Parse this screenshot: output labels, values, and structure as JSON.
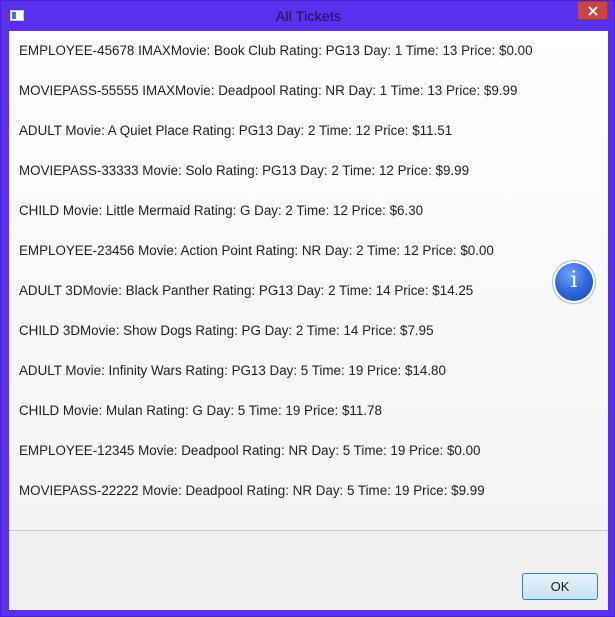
{
  "window": {
    "title": "All Tickets",
    "icon": "app-window-icon",
    "close_icon": "close-x-icon"
  },
  "tickets": [
    "EMPLOYEE-45678 IMAXMovie: Book Club Rating: PG13 Day: 1 Time: 13 Price: $0.00",
    "MOVIEPASS-55555 IMAXMovie: Deadpool Rating: NR Day: 1 Time: 13 Price: $9.99",
    "ADULT Movie: A Quiet Place Rating: PG13 Day: 2 Time: 12 Price: $11.51",
    "MOVIEPASS-33333 Movie: Solo Rating: PG13 Day: 2 Time: 12 Price: $9.99",
    "CHILD Movie: Little Mermaid Rating: G Day: 2 Time: 12 Price: $6.30",
    "EMPLOYEE-23456 Movie: Action Point Rating: NR Day: 2 Time: 12 Price: $0.00",
    "ADULT 3DMovie: Black Panther Rating: PG13 Day: 2 Time: 14 Price: $14.25",
    "CHILD 3DMovie: Show Dogs Rating: PG Day: 2 Time: 14 Price: $7.95",
    "ADULT Movie: Infinity Wars Rating: PG13 Day: 5 Time: 19 Price: $14.80",
    "CHILD Movie: Mulan Rating: G Day: 5 Time: 19 Price: $11.78",
    "EMPLOYEE-12345 Movie: Deadpool Rating: NR Day: 5 Time: 19 Price: $0.00",
    "MOVIEPASS-22222 Movie: Deadpool Rating: NR Day: 5 Time: 19 Price: $9.99"
  ],
  "info_icon": {
    "glyph": "i",
    "icon": "info-icon"
  },
  "footer": {
    "ok_label": "OK"
  },
  "colors": {
    "window_frame": "#5a2fee",
    "close_button": "#c74545",
    "info_icon": "#2c63d6",
    "ok_button_border": "#3c7fb1"
  }
}
